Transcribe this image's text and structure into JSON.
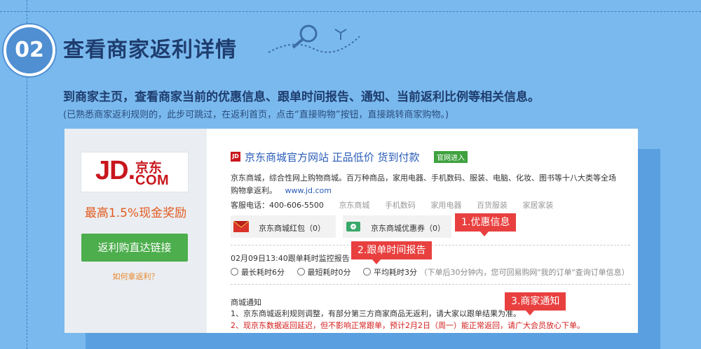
{
  "step": {
    "number": "02",
    "title": "查看商家返利详情"
  },
  "intro": {
    "text": "到商家主页，查看商家当前的优惠信息、跟单时间报告、通知、当前返利比例等相关信息。",
    "sub": "(已熟悉商家返利规则的，此步可跳过，在返利首页，点击“直接购物”按钮，直接跳转商家购物。)"
  },
  "merchant": {
    "logo_jd": "JD.",
    "logo_cn": "京东",
    "logo_com": "COM",
    "reward": "最高1.5%现金奖励",
    "button": "返利购直达链接",
    "how": "如何拿返利？"
  },
  "store": {
    "mini_logo": "JD",
    "title": "京东商城官方网站 正品低价 货到付款",
    "official": "官网进入",
    "desc": "京东商城，综合性网上购物商城。百万种商品，家用电器、手机数码、服装、电脑、化妆、图书等十八大类等全场购物拿返利。",
    "url": "www.jd.com",
    "phone": "客服电话：400-606-5500",
    "categories": [
      "京东商城",
      "手机数码",
      "家用电器",
      "百货服装",
      "家居家装"
    ],
    "coupon1": "京东商城红包（0）",
    "coupon2": "京东商城优惠券（0）",
    "monitor": "02月09日13:40跟单耗时监控报告",
    "longest": "最长耗时6分",
    "shortest": "最短耗时0分",
    "average": "平均耗时3分",
    "time_note": "（下单后30分钟内，您可回易购网\"我的订单\"查询订单信息）",
    "notice_title": "商城通知",
    "notice1": "1、京东商城返利规则调整，有部分第三方商家商品无返利，请大家以跟单结果为准。",
    "notice2": "2、现京东数据返回延迟，但不影响正常跟单，预计2月2日（周一）能正常返回，请广大会员放心下单。"
  },
  "tags": {
    "t1": "1.优惠信息",
    "t2": "2.跟单时间报告",
    "t3": "3.商家通知"
  },
  "colors": {
    "accent_blue": "#4f8fd2",
    "jd_red": "#c8161d",
    "green": "#4cae4c",
    "tag_red": "#e8403f"
  }
}
